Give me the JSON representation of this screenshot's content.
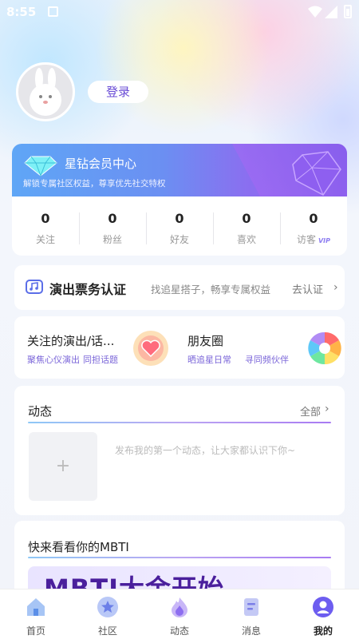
{
  "status_bar": {
    "time": "8:55"
  },
  "profile": {
    "login_label": "登录"
  },
  "vip": {
    "title": "星钻会员中心",
    "subtitle": "解锁专属社区权益，尊享优先社交特权",
    "vip_tag": "VIP",
    "stats": [
      {
        "value": "0",
        "label": "关注"
      },
      {
        "value": "0",
        "label": "粉丝"
      },
      {
        "value": "0",
        "label": "好友"
      },
      {
        "value": "0",
        "label": "喜欢"
      },
      {
        "value": "0",
        "label": "访客"
      }
    ]
  },
  "ticket_cert": {
    "title": "演出票务认证",
    "subtitle": "找追星搭子，畅享专属权益",
    "link": "去认证",
    "chevron": "›"
  },
  "features": [
    {
      "title": "关注的演出/话...",
      "sub1": "聚焦心仪演出",
      "sub2": "同担话题",
      "icon": "heart-icon"
    },
    {
      "title": "朋友圈",
      "sub1": "晒追星日常",
      "sub2": "寻同频伙伴",
      "icon": "aperture-icon"
    }
  ],
  "dynamics": {
    "title": "动态",
    "all_label": "全部",
    "chevron": "›",
    "add_symbol": "+",
    "prompt": "发布我的第一个动态，让大家都认识下你~"
  },
  "mbti": {
    "title": "快来看看你的MBTI",
    "banner_text": "MBTI大金开始"
  },
  "bottom_nav": [
    {
      "label": "首页",
      "icon": "home-icon"
    },
    {
      "label": "社区",
      "icon": "star-icon"
    },
    {
      "label": "动态",
      "icon": "flame-icon"
    },
    {
      "label": "消息",
      "icon": "message-icon"
    },
    {
      "label": "我的",
      "icon": "profile-icon",
      "active": true
    }
  ],
  "colors": {
    "accent": "#6a4cd6",
    "vip_gradient_start": "#5fa6f6",
    "vip_gradient_end": "#9a5ef1"
  }
}
